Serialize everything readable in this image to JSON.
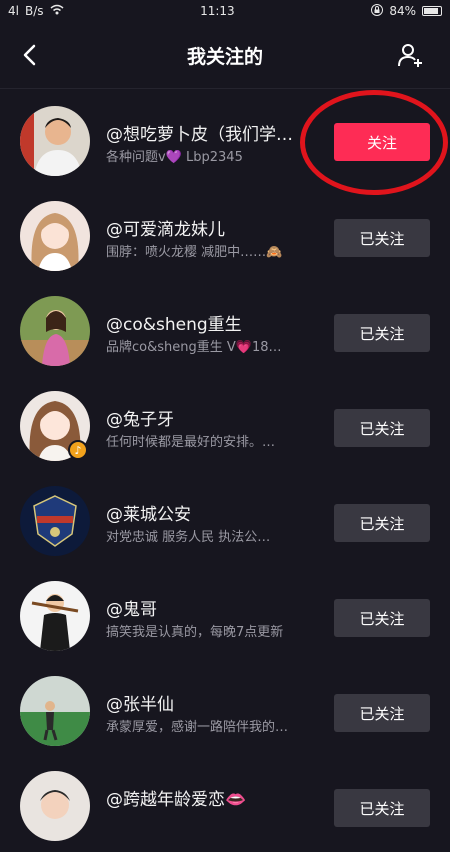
{
  "status_bar": {
    "signal": "4l",
    "speed": "B/s",
    "time": "11:13",
    "battery_percent": "84%"
  },
  "nav": {
    "title": "我关注的",
    "back_icon": "chevron-left-icon",
    "add_icon": "add-user-icon"
  },
  "colors": {
    "background": "#17161f",
    "follow_button": "#fe2c55",
    "followed_button": "#393841",
    "annotation_circle": "#e0141c"
  },
  "users": [
    {
      "name": "@想吃萝卜皮（我们学…",
      "desc": "各种问题v💜 Lbp2345",
      "button": "关注"
    },
    {
      "name": "@可爱滴龙妹儿",
      "desc": "围脖：喷火龙樱 减肥中……🙈",
      "button": "已关注"
    },
    {
      "name": "@co&sheng重生",
      "desc": "品牌co&sheng重生 V💗18…",
      "button": "已关注"
    },
    {
      "name": "@兔子牙",
      "desc": "任何时候都是最好的安排。…",
      "button": "已关注"
    },
    {
      "name": "@莱城公安",
      "desc": "对党忠诚 服务人民 执法公…",
      "button": "已关注"
    },
    {
      "name": "@鬼哥",
      "desc": "搞笑我是认真的，每晚7点更新",
      "button": "已关注"
    },
    {
      "name": "@张半仙",
      "desc": "承蒙厚爱，感谢一路陪伴我的…",
      "button": "已关注"
    },
    {
      "name": "@跨越年龄爱恋👄",
      "desc": "",
      "button": "已关注"
    }
  ]
}
